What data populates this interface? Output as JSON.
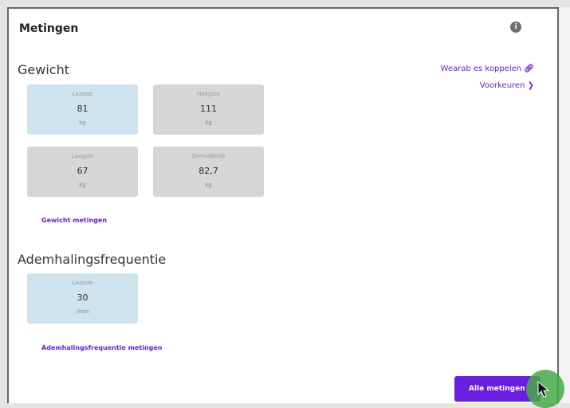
{
  "card": {
    "title": "Metingen",
    "info_icon": "info-icon"
  },
  "links": {
    "wearables": "Wearab es koppelen",
    "wearables_icon": "link-icon",
    "voorkeuren": "Voorkeuren",
    "voorkeuren_icon": "chevron-right-icon"
  },
  "gewicht": {
    "title": "Gewicht",
    "tiles": [
      {
        "label": "Laatste",
        "value": "81",
        "unit": "kg"
      },
      {
        "label": "Hoogste",
        "value": "111",
        "unit": "kg"
      },
      {
        "label": "Laagste",
        "value": "67",
        "unit": "kg"
      },
      {
        "label": "Gemiddelde",
        "value": "82,7",
        "unit": "kg"
      }
    ],
    "action": "Gewicht metingen"
  },
  "ademhaling": {
    "title": "Ademhalingsfrequentie",
    "tiles": [
      {
        "label": "Laatste",
        "value": "30",
        "unit": "/min"
      }
    ],
    "action": "Ademhalingsfrequentie metingen"
  },
  "footer": {
    "all_button": "Alle metingen"
  },
  "colors": {
    "accent": "#6a1fe0",
    "tile_highlight": "#cde3ee",
    "tile_default": "#d6d6d6",
    "cursor_highlight": "#46aa46"
  }
}
